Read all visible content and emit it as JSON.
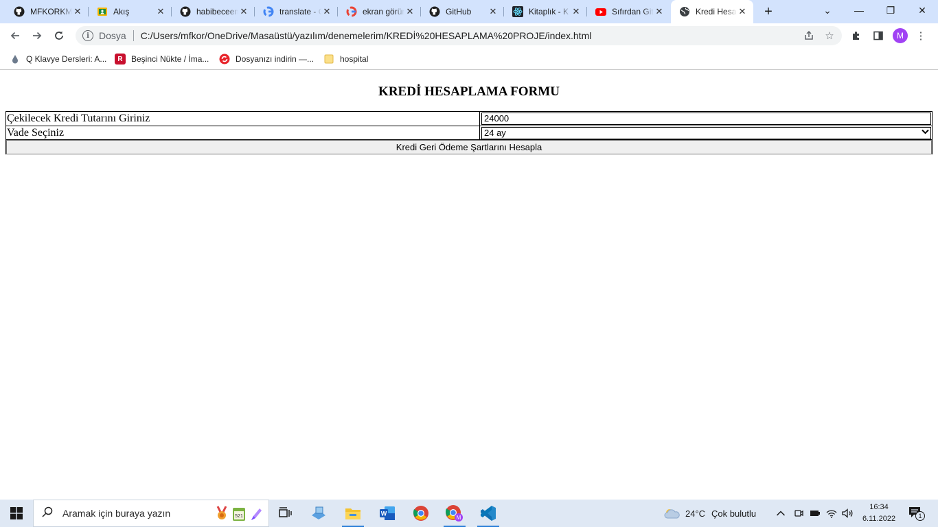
{
  "browser": {
    "tabs": [
      {
        "title": "MFKORKMAZ",
        "icon": "github-icon"
      },
      {
        "title": "Akış",
        "icon": "classroom-icon"
      },
      {
        "title": "habibeceem",
        "icon": "github-icon"
      },
      {
        "title": "translate - Google",
        "icon": "google-icon"
      },
      {
        "title": "ekran görüntüsü",
        "icon": "google-icon"
      },
      {
        "title": "GitHub",
        "icon": "github-icon"
      },
      {
        "title": "Kitaplık - K",
        "icon": "react-icon"
      },
      {
        "title": "Sıfırdan Git",
        "icon": "youtube-icon"
      },
      {
        "title": "Kredi Hesapla",
        "icon": "globe-icon",
        "active": true
      }
    ],
    "new_tab": "+",
    "window_controls": {
      "menu": "⌄",
      "minimize": "—",
      "restore": "❐",
      "close": "✕"
    },
    "address": {
      "scheme_label": "Dosya",
      "url": "C:/Users/mfkor/OneDrive/Masaüstü/yazılım/denemelerim/KREDİ%20HESAPLAMA%20PROJE/index.html"
    },
    "profile_initial": "M",
    "bookmarks": [
      {
        "label": "Q Klavye Dersleri: A...",
        "icon": "droplet-icon"
      },
      {
        "label": "Beşinci Nükte / İma...",
        "icon": "book-icon"
      },
      {
        "label": "Dosyanızı indirin —...",
        "icon": "download-icon"
      },
      {
        "label": "hospital",
        "icon": "folder-icon"
      }
    ]
  },
  "page": {
    "title": "KREDİ HESAPLAMA FORMU",
    "amount_label": "Çekilecek Kredi Tutarını Giriniz",
    "amount_value": "24000",
    "term_label": "Vade Seçiniz",
    "term_value": "24 ay",
    "submit_label": "Kredi Geri Ödeme Şartlarını Hesapla"
  },
  "taskbar": {
    "search_placeholder": "Aramak için buraya yazın",
    "weather_temp": "24°C",
    "weather_desc": "Çok bulutlu",
    "time": "16:34",
    "date": "6.11.2022",
    "notification_count": "1"
  },
  "colors": {
    "tabstrip_bg": "#d3e3fd",
    "taskbar_bg": "#dfe8f4",
    "accent_blue": "#2b7fd8",
    "profile": "#a142f4"
  }
}
